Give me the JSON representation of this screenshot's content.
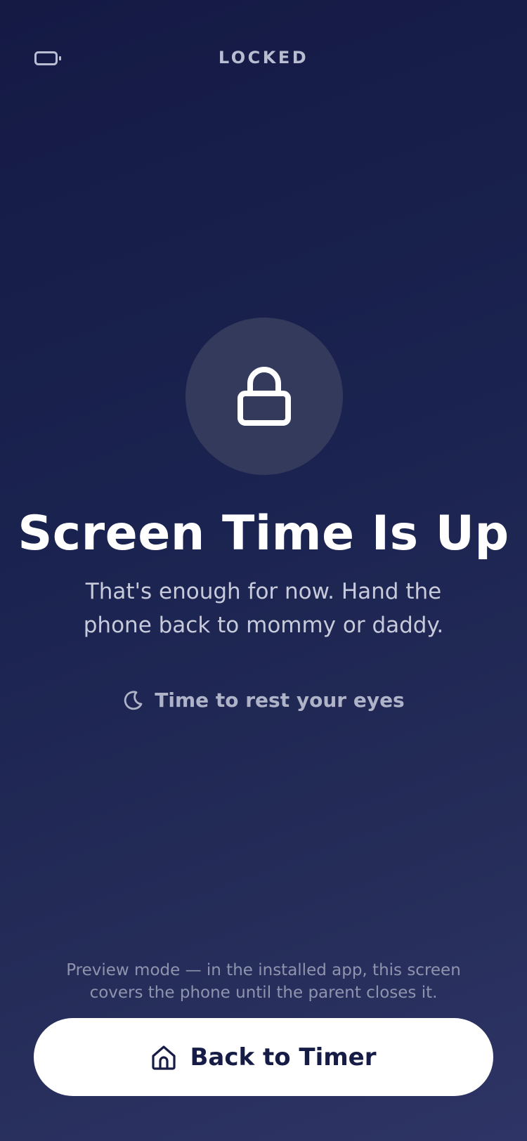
{
  "header": {
    "title": "LOCKED",
    "status_icon": "battery-icon"
  },
  "lock": {
    "icon": "lock-icon"
  },
  "main": {
    "headline": "Screen Time Is Up",
    "message": "That's enough for now. Hand the phone back to mommy or daddy.",
    "rest_icon": "moon-icon",
    "rest_text": "Time to rest your eyes"
  },
  "footer": {
    "preview_note": "Preview mode — in the installed app, this screen covers the phone until the parent closes it.",
    "button_icon": "home-icon",
    "button_label": "Back to Timer"
  },
  "colors": {
    "background_top": "#141a44",
    "background_bottom": "#2e3566",
    "lock_circle": "#343a5c",
    "button_bg": "#ffffff",
    "button_text": "#161c45"
  }
}
